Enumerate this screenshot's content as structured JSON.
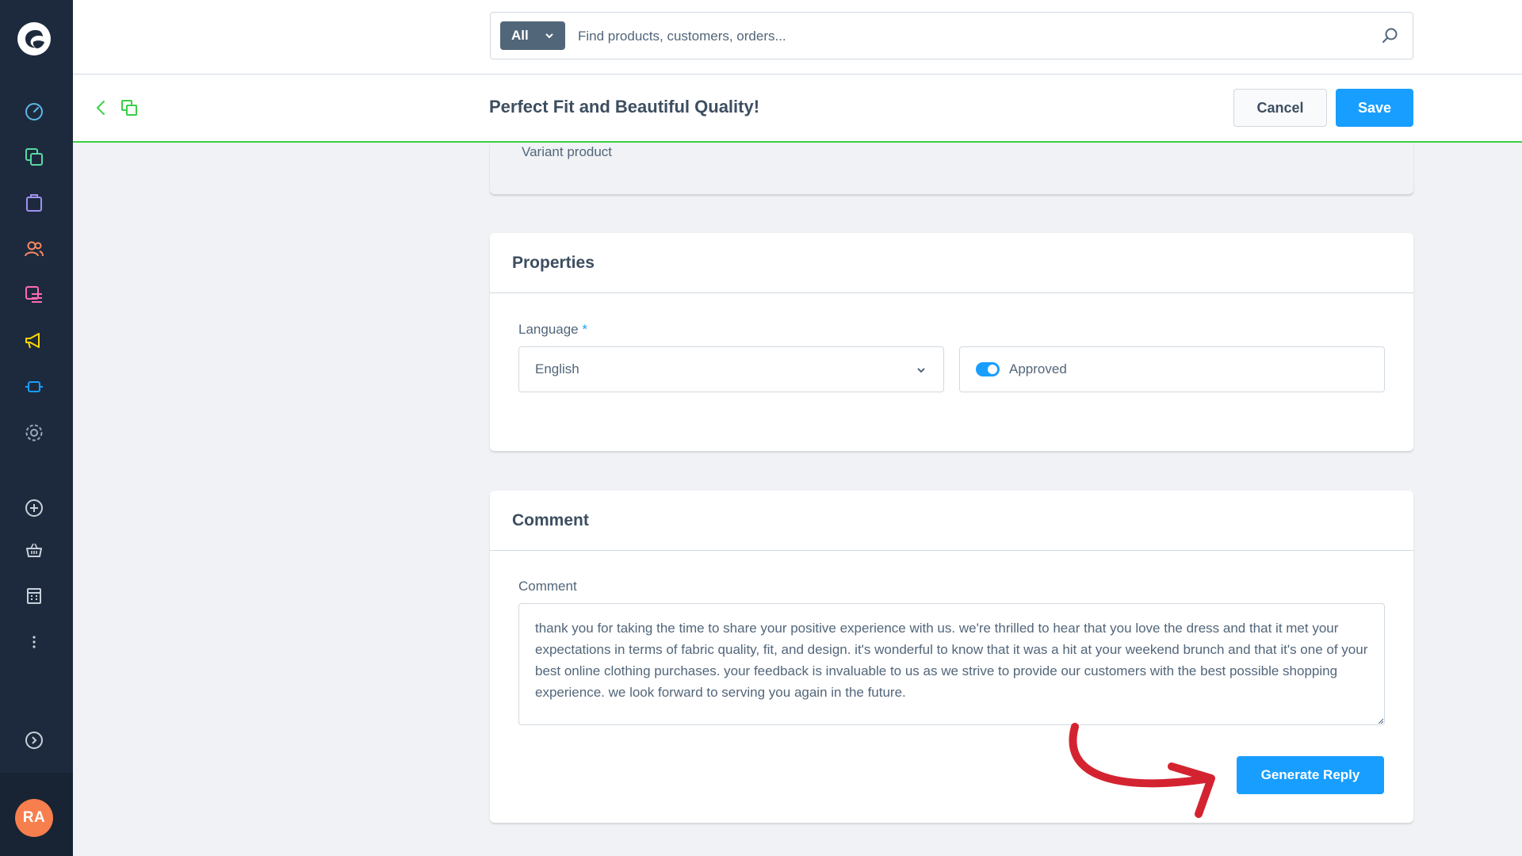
{
  "sidebar": {
    "avatar_initials": "RA",
    "icons": [
      "dashboard-icon",
      "catalog-icon",
      "orders-icon",
      "customers-icon",
      "content-icon",
      "marketing-icon",
      "extensions-icon",
      "settings-icon",
      "add-icon",
      "sales-channel-basket-icon",
      "sales-channel-store-icon",
      "more-icon",
      "expand-icon"
    ]
  },
  "search": {
    "type_label": "All",
    "placeholder": "Find products, customers, orders..."
  },
  "smartbar": {
    "title": "Perfect Fit and Beautiful Quality!",
    "cancel_label": "Cancel",
    "save_label": "Save"
  },
  "product": {
    "variant_label": "Variant product"
  },
  "properties": {
    "title": "Properties",
    "language_label": "Language",
    "required_marker": "*",
    "language_value": "English",
    "approved_label": "Approved"
  },
  "comment": {
    "title": "Comment",
    "field_label": "Comment",
    "value": "thank you for taking the time to share your positive experience with us. we're thrilled to hear that you love the dress and that it met your expectations in terms of fabric quality, fit, and design. it's wonderful to know that it was a hit at your weekend brunch and that it's one of your best online clothing purchases. your feedback is invaluable to us as we strive to provide our customers with the best possible shopping experience. we look forward to serving you again in the future.",
    "generate_label": "Generate Reply"
  },
  "colors": {
    "sidebar": "#1d2a3e",
    "primary": "#189eff",
    "accent_green": "#37d046",
    "avatar": "#f77e4d",
    "annotation_arrow": "#d42330"
  }
}
